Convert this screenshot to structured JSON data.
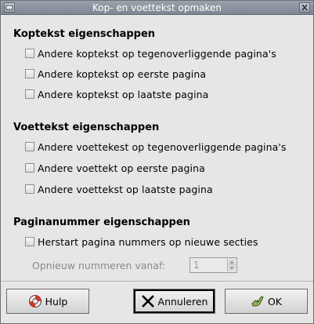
{
  "window": {
    "title": "Kop- en voettekst opmaken"
  },
  "header_section": {
    "title": "Koptekst eigenschappen",
    "options": [
      {
        "label": "Andere koptekst op tegenoverliggende pagina's",
        "checked": false
      },
      {
        "label": "Andere koptekst op eerste pagina",
        "checked": false
      },
      {
        "label": "Andere koptekst op laatste pagina",
        "checked": false
      }
    ]
  },
  "footer_section": {
    "title": "Voettekst eigenschappen",
    "options": [
      {
        "label": "Andere voettekest op tegenoverliggende pagina's",
        "checked": false
      },
      {
        "label": "Andere voettekt op eerste pagina",
        "checked": false
      },
      {
        "label": "Andere voettekst op laatste pagina",
        "checked": false
      }
    ]
  },
  "page_number_section": {
    "title": "Paginanummer eigenschappen",
    "restart_option": {
      "label": "Herstart pagina nummers op nieuwe secties",
      "checked": false
    },
    "renumber_from": {
      "label": "Opnieuw nummeren vanaf:",
      "value": "1",
      "enabled": false
    }
  },
  "buttons": {
    "help": "Hulp",
    "cancel": "Annuleren",
    "ok": "OK"
  },
  "icons": {
    "help": "lifebuoy-icon",
    "cancel": "x-icon",
    "ok": "ok-hand-icon"
  }
}
